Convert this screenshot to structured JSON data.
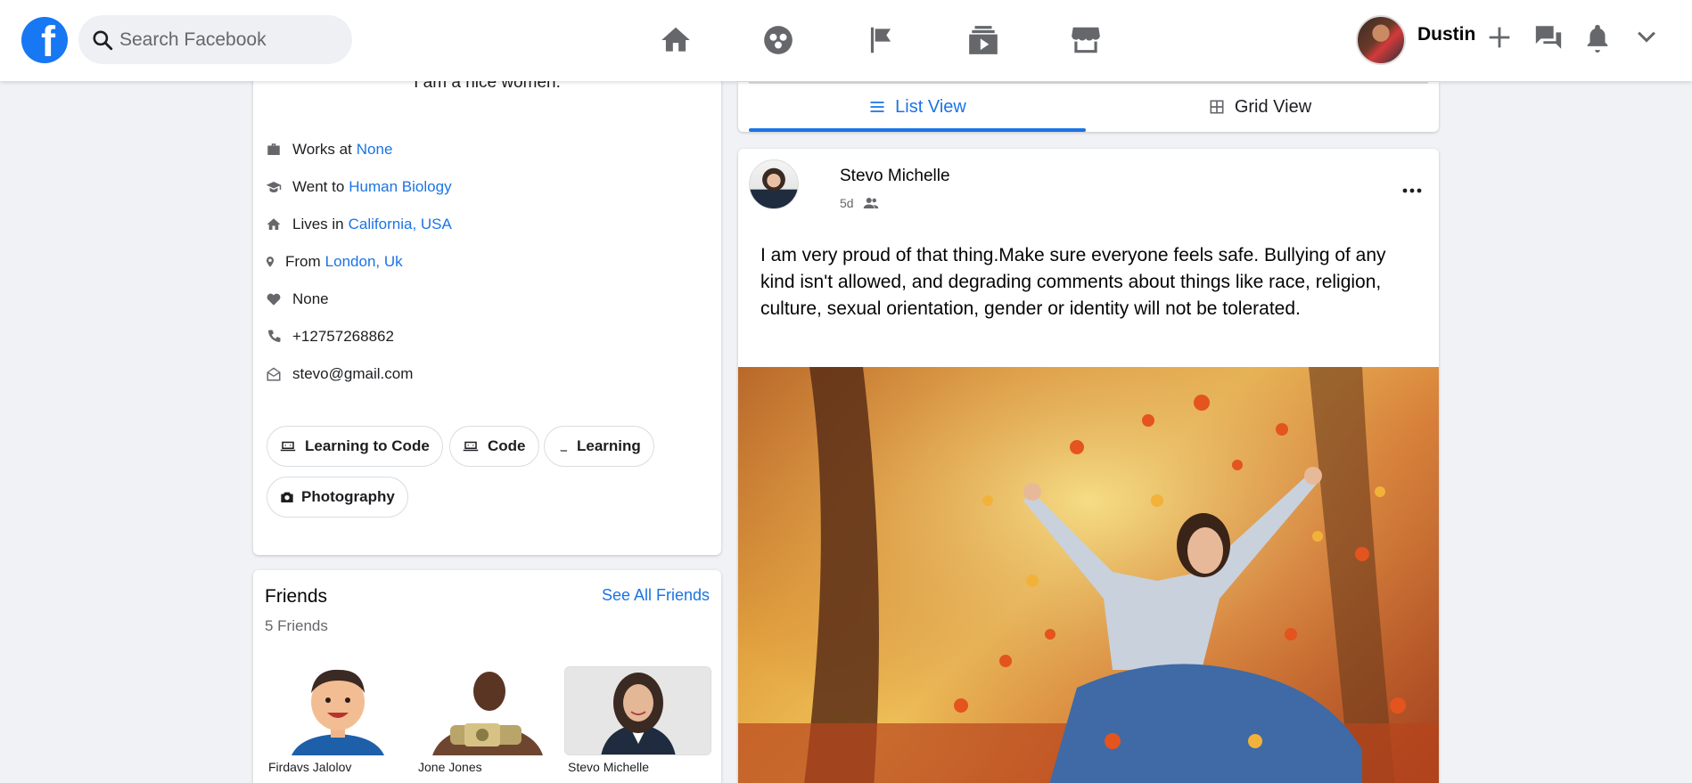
{
  "header": {
    "logo_letter": "f",
    "search_placeholder": "Search Facebook",
    "nav": [
      "home-icon",
      "groups-icon",
      "pages-flag-icon",
      "watch-icon",
      "marketplace-icon"
    ],
    "user_name": "Dustin",
    "right_icons": [
      "plus-icon",
      "messenger-icon",
      "notifications-icon",
      "chevron-down-icon"
    ]
  },
  "intro": {
    "bio": "I am a nice women.",
    "works_prefix": "Works at",
    "works_value": "None",
    "went_prefix": "Went to",
    "went_value": "Human Biology",
    "lives_prefix": "Lives in",
    "lives_value": "California, USA",
    "from_prefix": "From",
    "from_value": "London, Uk",
    "relationship": "None",
    "phone": "+12757268862",
    "email": "stevo@gmail.com",
    "hobbies": [
      "Learning to Code",
      "Code",
      "Learning",
      "Photography"
    ]
  },
  "friends": {
    "title": "Friends",
    "count": "5 Friends",
    "see_all": "See All Friends",
    "list": [
      "Firdavs Jalolov",
      "Jone Jones",
      "Stevo Michelle"
    ]
  },
  "view_tabs": {
    "list": "List View",
    "grid": "Grid View",
    "active": "list"
  },
  "post": {
    "author": "Stevo Michelle",
    "time": "5d",
    "text": "I am very proud of that thing.Make sure everyone feels safe. Bullying of any kind isn't allowed, and degrading comments about things like race, religion, culture, sexual orientation, gender or identity will not be tolerated."
  },
  "colors": {
    "brand": "#1877f2",
    "link": "#1b74e4",
    "background": "#f0f2f5"
  }
}
